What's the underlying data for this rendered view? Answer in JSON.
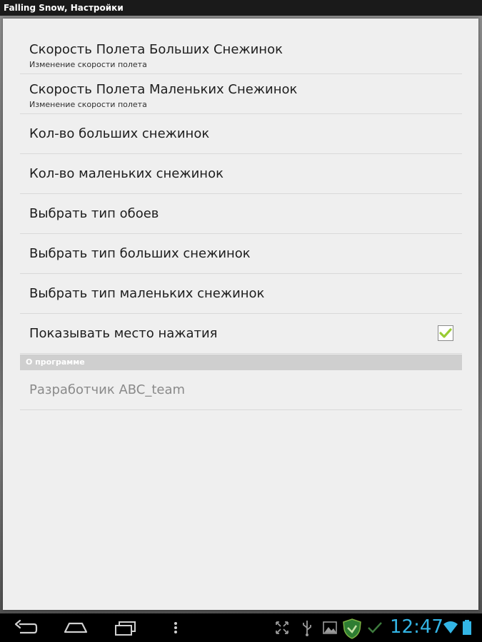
{
  "window": {
    "title": "Falling Snow, Настройки"
  },
  "settings": {
    "items": [
      {
        "title": "Скорость Полета Больших Снежинок",
        "summary": "Изменение скорости полета"
      },
      {
        "title": "Скорость Полета Маленьких Снежинок",
        "summary": "Изменение скорости полета"
      },
      {
        "title": "Кол-во больших снежинок"
      },
      {
        "title": "Кол-во маленьких снежинок"
      },
      {
        "title": "Выбрать тип обоев"
      },
      {
        "title": "Выбрать тип больших снежинок"
      },
      {
        "title": "Выбрать тип маленьких снежинок"
      },
      {
        "title": "Показывать место нажатия",
        "checked": true
      }
    ],
    "about_section": {
      "header": "О программе",
      "developer": "Разработчик ABC_team"
    }
  },
  "navbar": {
    "buttons": [
      "back-icon",
      "home-icon",
      "recent-apps-icon",
      "menu-icon"
    ],
    "status_icons": [
      "screen-compat-icon",
      "usb-icon",
      "gallery-icon",
      "security-shield-icon",
      "done-check-icon",
      "wifi-icon",
      "battery-icon"
    ],
    "clock": "12:47",
    "clock_color": "#33b5e5"
  }
}
